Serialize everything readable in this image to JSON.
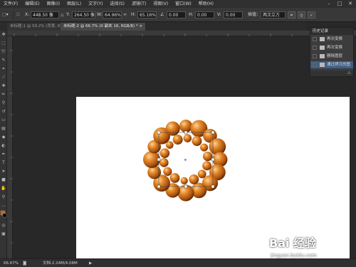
{
  "menubar": {
    "items": [
      "文件(F)",
      "编辑(E)",
      "图像(I)",
      "图层(L)",
      "文字(Y)",
      "选择(S)",
      "滤镜(T)",
      "视图(V)",
      "窗口(W)",
      "帮助(H)"
    ]
  },
  "options": {
    "x_label": "X:",
    "x_value": "448.50 像",
    "y_label": "Y:",
    "y_value": "264.50 像",
    "w_label": "W:",
    "w_value": "64.96%",
    "h_label": "H:",
    "h_value": "65.16%",
    "angle_value": "0.00",
    "hskew_label": "H:",
    "hskew_value": "0.00",
    "vskew_label": "V:",
    "vskew_value": "0.00",
    "interp_label": "插值：",
    "interp_value": "两次立方"
  },
  "tabs": [
    {
      "label": "未标题-1 @ 59.2% (背景, RGB/8) ×"
    },
    {
      "label": "未标题-2 @ 66.7% (0 副本 16, RGB/8) * ×"
    }
  ],
  "history": {
    "title": "历史记录",
    "items": [
      {
        "label": "再次变换"
      },
      {
        "label": "再次变换"
      },
      {
        "label": "删除图层"
      },
      {
        "label": "通过拷贝的图"
      }
    ]
  },
  "status": {
    "zoom": "66.67%",
    "doc_info": "文档:2.24M/4.08M"
  },
  "watermark": {
    "logo": "Bai 经验",
    "url": "jingyan.baidu.com"
  },
  "colors": {
    "sphere_light": "#f4b070",
    "sphere_mid": "#d9781f",
    "sphere_dark": "#6e3305",
    "selection": "#3f5f86"
  }
}
